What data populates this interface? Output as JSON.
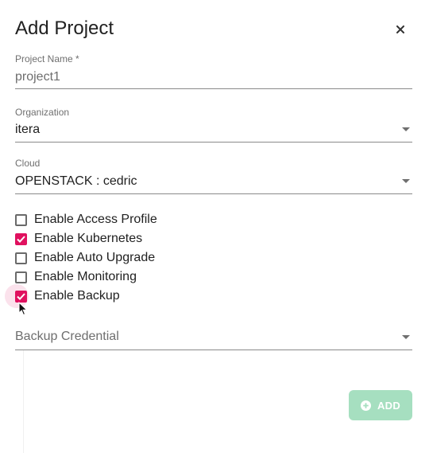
{
  "dialog": {
    "title": "Add Project",
    "close_icon": "close-icon"
  },
  "fields": {
    "project_name": {
      "label": "Project Name *",
      "value": "project1"
    },
    "organization": {
      "label": "Organization",
      "value": "itera"
    },
    "cloud": {
      "label": "Cloud",
      "value": "OPENSTACK : cedric"
    },
    "backup_credential": {
      "placeholder": "Backup Credential"
    }
  },
  "options": [
    {
      "label": "Enable Access Profile",
      "checked": false
    },
    {
      "label": "Enable Kubernetes",
      "checked": true
    },
    {
      "label": "Enable Auto Upgrade",
      "checked": false
    },
    {
      "label": "Enable Monitoring",
      "checked": false
    },
    {
      "label": "Enable Backup",
      "checked": true
    }
  ],
  "actions": {
    "add_label": "ADD",
    "add_icon": "plus-circle-icon"
  },
  "colors": {
    "accent": "#e0115f",
    "add_button_bg": "#a6dfc0"
  }
}
